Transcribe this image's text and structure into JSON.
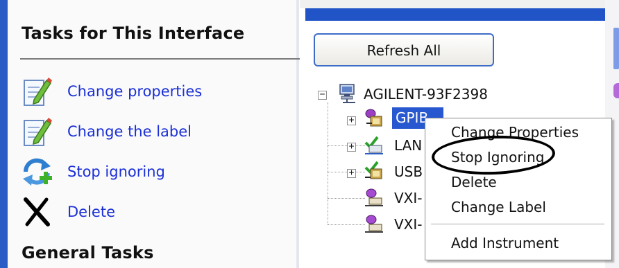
{
  "task_pane": {
    "title": "Tasks for This Interface",
    "tasks": [
      {
        "label": "Change properties",
        "icon": "edit-document-icon"
      },
      {
        "label": "Change the label",
        "icon": "edit-document-icon"
      },
      {
        "label": "Stop ignoring",
        "icon": "refresh-add-icon"
      },
      {
        "label": "Delete",
        "icon": "delete-x-icon"
      }
    ],
    "general_title": "General Tasks"
  },
  "right_pane": {
    "refresh_button": "Refresh All",
    "tree": {
      "root": {
        "label": "AGILENT-93F2398",
        "icon": "computer-network-icon",
        "expander": "−"
      },
      "children": [
        {
          "label": "GPIB",
          "icon": "gpib-interface-icon",
          "expander": "+",
          "selected": true
        },
        {
          "label": "LAN",
          "icon": "lan-interface-icon",
          "expander": "+"
        },
        {
          "label": "USB",
          "icon": "usb-interface-icon",
          "expander": "+"
        },
        {
          "label": "VXI-",
          "icon": "vxi-interface-icon"
        },
        {
          "label": "VXI-",
          "icon": "vxi-interface-icon"
        }
      ]
    }
  },
  "context_menu": {
    "items": [
      "Change Properties",
      "Stop Ignoring",
      "Delete",
      "Change Label"
    ],
    "extra": [
      "Add Instrument"
    ],
    "highlighted": "Stop Ignoring"
  },
  "colors": {
    "accent": "#2155c7",
    "link": "#1a2fd6",
    "selection": "#2758cf"
  }
}
